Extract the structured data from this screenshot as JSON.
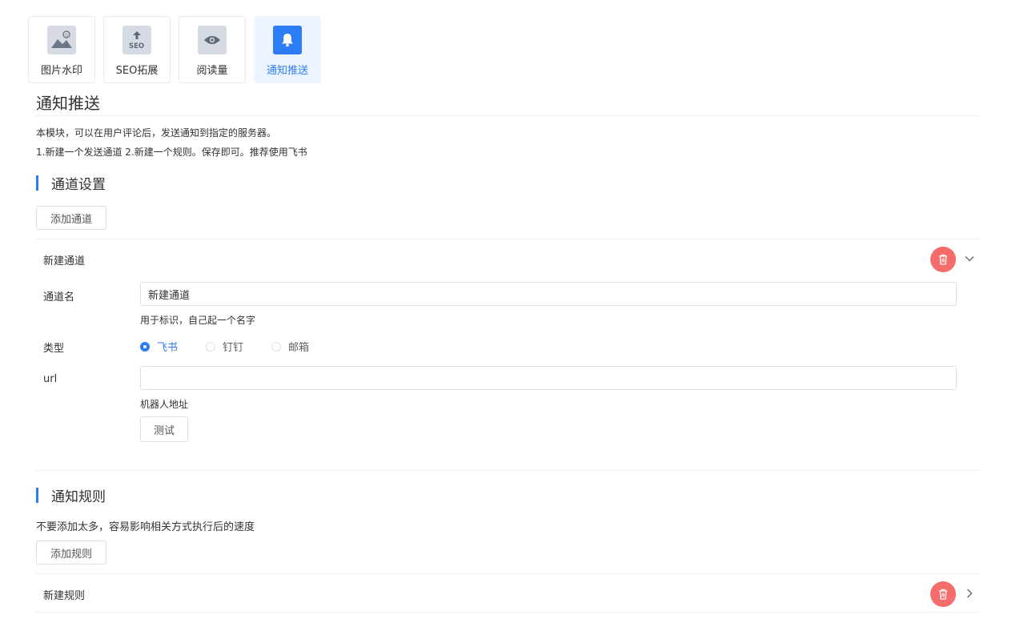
{
  "tabs": [
    {
      "label": "图片水印",
      "icon": "image-icon",
      "active": false
    },
    {
      "label": "SEO拓展",
      "icon": "seo-upload-icon",
      "active": false
    },
    {
      "label": "阅读量",
      "icon": "eye-icon",
      "active": false
    },
    {
      "label": "通知推送",
      "icon": "bell-icon",
      "active": true
    }
  ],
  "page": {
    "title": "通知推送",
    "desc1": "本模块，可以在用户评论后，发送通知到指定的服务器。",
    "desc2": "1.新建一个发送通道 2.新建一个规则。保存即可。推荐使用飞书"
  },
  "channel_section": {
    "title": "通道设置",
    "add_button": "添加通道",
    "item": {
      "title": "新建通道",
      "name_label": "通道名",
      "name_value": "新建通道",
      "name_hint": "用于标识，自己起一个名字",
      "type_label": "类型",
      "type_options": [
        "飞书",
        "钉钉",
        "邮箱"
      ],
      "type_selected": "飞书",
      "url_label": "url",
      "url_value": "",
      "url_hint": "机器人地址",
      "test_button": "测试"
    }
  },
  "rule_section": {
    "title": "通知规则",
    "desc": "不要添加太多，容易影响相关方式执行后的速度",
    "add_button": "添加规则",
    "item": {
      "title": "新建规则"
    }
  },
  "colors": {
    "primary": "#2d7cf6",
    "danger": "#f56c6c",
    "border": "#dcdfe6"
  }
}
